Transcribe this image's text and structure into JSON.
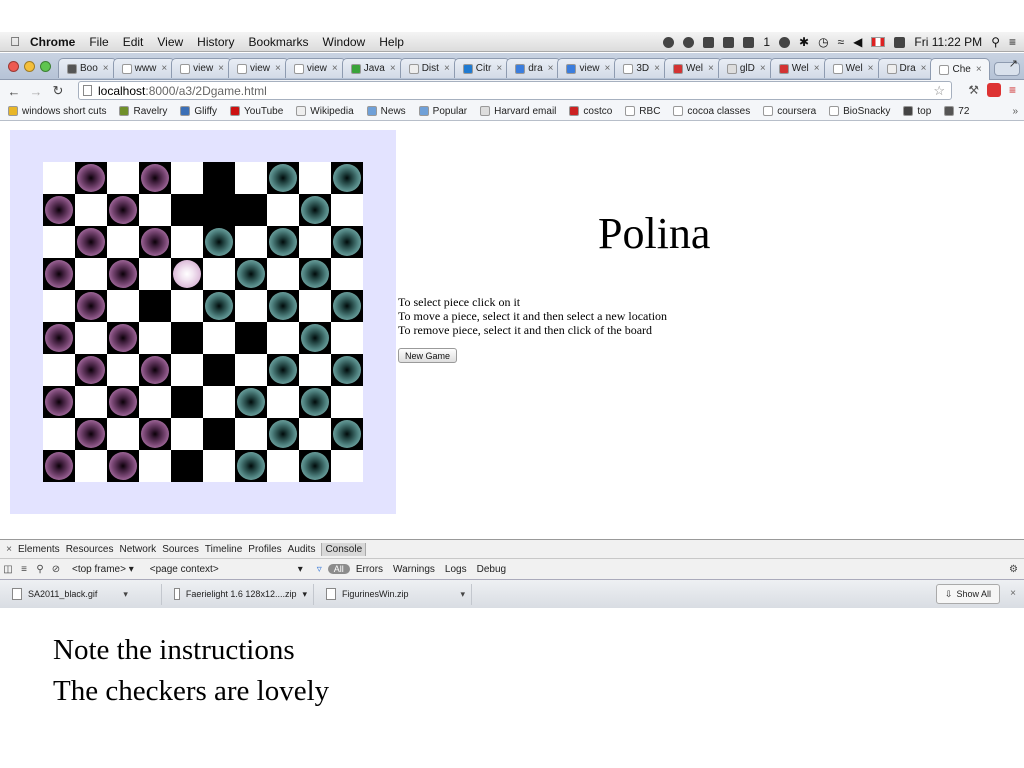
{
  "menubar": {
    "app": "Chrome",
    "menus": [
      "File",
      "Edit",
      "View",
      "History",
      "Bookmarks",
      "Window",
      "Help"
    ],
    "mail_count": "1",
    "clock": "Fri 11:22 PM"
  },
  "tabs": [
    {
      "label": "Boo",
      "color": "#555555"
    },
    {
      "label": "www",
      "color": "#ffffff"
    },
    {
      "label": "view",
      "color": "#ffffff"
    },
    {
      "label": "view",
      "color": "#ffffff"
    },
    {
      "label": "view",
      "color": "#ffffff"
    },
    {
      "label": "Java",
      "color": "#3aa33a"
    },
    {
      "label": "Dist",
      "color": "#eeeeee"
    },
    {
      "label": "Citr",
      "color": "#1f7ad1"
    },
    {
      "label": "dra",
      "color": "#3b7ddd"
    },
    {
      "label": "view",
      "color": "#3b7ddd"
    },
    {
      "label": "3D",
      "color": "#ffffff"
    },
    {
      "label": "Wel",
      "color": "#d33333"
    },
    {
      "label": "glD",
      "color": "#dddddd"
    },
    {
      "label": "Wel",
      "color": "#d33333"
    },
    {
      "label": "Wel",
      "color": "#ffffff"
    },
    {
      "label": "Dra",
      "color": "#eeeeee"
    },
    {
      "label": "Che",
      "color": "#ffffff",
      "active": true
    }
  ],
  "address": {
    "host": "localhost",
    "path": ":8000/a3/2Dgame.html"
  },
  "bookmarks": [
    {
      "label": "windows short cuts",
      "color": "#e8b628"
    },
    {
      "label": "Ravelry",
      "color": "#6f8f2a"
    },
    {
      "label": "Gliffy",
      "color": "#3b6fb6"
    },
    {
      "label": "YouTube",
      "color": "#cc1111"
    },
    {
      "label": "Wikipedia",
      "color": "#eeeeee"
    },
    {
      "label": "News",
      "color": "#6fa0d8"
    },
    {
      "label": "Popular",
      "color": "#6fa0d8"
    },
    {
      "label": "Harvard email",
      "color": "#dddddd"
    },
    {
      "label": "costco",
      "color": "#cc2222"
    },
    {
      "label": "RBC",
      "color": "#ffffff"
    },
    {
      "label": "cocoa classes",
      "color": "#ffffff"
    },
    {
      "label": "coursera",
      "color": "#ffffff"
    },
    {
      "label": "BioSnacky",
      "color": "#ffffff"
    },
    {
      "label": "top",
      "color": "#444444"
    },
    {
      "label": "72",
      "color": "#555555"
    }
  ],
  "game": {
    "player_name": "Polina",
    "instructions": [
      "To select piece click on it",
      "To move a piece, select it and then select a new location",
      "To remove piece, select it and then click of the board"
    ],
    "new_game_label": "New Game",
    "board": {
      "squares": [
        "LDLDLDLDLD",
        "DLDLDDDLDL",
        "LDLDLDLDLD",
        "DLDLDLDLDL",
        "LDLDLDLDLD",
        "DLDLDLDLDL",
        "LDLDLDLDLD",
        "DLDLDLDLDL",
        "LDLDLDLDLD",
        "DLDLDLDLDL"
      ],
      "pieces": [
        "-P-P-D-T-T",
        "P-P-D-D-T-",
        "-P-P-T-T-T",
        "P-P-S-T-T-",
        "-P-D-T-T-T",
        "P-P-D-D-T-",
        "-P-P-D-T-T",
        "P-P-D-T-T-",
        "-P-P-D-T-T",
        "P-P-D-T-T-"
      ],
      "colors": {
        "pink": "#7d4a78",
        "teal": "#4f8280",
        "selected": "#f3e6f2",
        "background": "#e3e3ff"
      }
    }
  },
  "devtools": {
    "tabs": [
      "Elements",
      "Resources",
      "Network",
      "Sources",
      "Timeline",
      "Profiles",
      "Audits",
      "Console"
    ],
    "active_tab": "Console",
    "frame": "<top frame>",
    "context": "<page context>",
    "filter_all": "All",
    "levels": [
      "Errors",
      "Warnings",
      "Logs",
      "Debug"
    ]
  },
  "downloads": {
    "items": [
      "SA2011_black.gif",
      "Faerielight 1.6 128x12....zip",
      "FigurinesWin.zip"
    ],
    "show_all_label": "Show All"
  },
  "caption": [
    "Note the instructions",
    "The checkers are lovely"
  ]
}
